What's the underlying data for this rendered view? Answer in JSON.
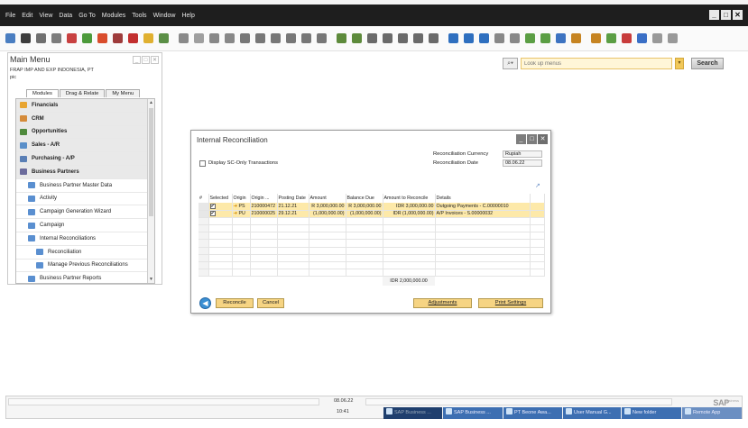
{
  "menubar": {
    "items": [
      "File",
      "Edit",
      "View",
      "Data",
      "Go To",
      "Modules",
      "Tools",
      "Window",
      "Help"
    ],
    "window_buttons": [
      "_",
      "□",
      "✕"
    ]
  },
  "search": {
    "placeholder": "Look up menus",
    "button": "Search"
  },
  "main_menu": {
    "title": "Main Menu",
    "company": "FRAP IMP AND EXP INDONESIA, PT",
    "user": "pic",
    "tabs": [
      "Modules",
      "Drag & Relate",
      "My Menu"
    ],
    "items": [
      {
        "label": "Financials",
        "level": 0,
        "color": "#e8a531"
      },
      {
        "label": "CRM",
        "level": 0,
        "color": "#d58b3a"
      },
      {
        "label": "Opportunities",
        "level": 0,
        "color": "#4f8a3c"
      },
      {
        "label": "Sales - A/R",
        "level": 0,
        "color": "#5a8fc9"
      },
      {
        "label": "Purchasing - A/P",
        "level": 0,
        "color": "#5a7fb5"
      },
      {
        "label": "Business Partners",
        "level": 0,
        "color": "#6b6b9c"
      },
      {
        "label": "Business Partner Master Data",
        "level": 1
      },
      {
        "label": "Activity",
        "level": 1
      },
      {
        "label": "Campaign Generation Wizard",
        "level": 1
      },
      {
        "label": "Campaign",
        "level": 1
      },
      {
        "label": "Internal Reconciliations",
        "level": 1
      },
      {
        "label": "Reconciliation",
        "level": 2
      },
      {
        "label": "Manage Previous Reconciliations",
        "level": 2
      },
      {
        "label": "Business Partner Reports",
        "level": 1
      }
    ]
  },
  "dialog": {
    "title": "Internal Reconciliation",
    "display_sc_only_label": "Display SC-Only Transactions",
    "reconciliation_currency_label": "Reconciliation Currency",
    "reconciliation_currency": "Rupiah",
    "reconciliation_date_label": "Reconciliation Date",
    "reconciliation_date": "08.06.22",
    "columns": [
      "#",
      "Selected",
      "Origin",
      "Origin ...",
      "Posting Date",
      "Amount",
      "Balance Due",
      "Amount to Reconcile",
      "Details"
    ],
    "rows": [
      {
        "origin": "PS",
        "origin_no": "210000472",
        "posting_date": "21.12.21",
        "amount": "R 3,000,000.00",
        "balance_due": "R 3,000,000.00",
        "amount_to_reconcile": "IDR 3,000,000.00",
        "details": "Outgoing Payments - C.00000010"
      },
      {
        "origin": "PU",
        "origin_no": "210000025",
        "posting_date": "29.12.21",
        "amount": "(1,000,000.00)",
        "balance_due": "(1,000,000.00)",
        "amount_to_reconcile": "IDR (1,000,000.00)",
        "details": "A/P Invoices - S.00000032"
      }
    ],
    "total": "IDR 2,000,000.00",
    "buttons": {
      "reconcile": "Reconcile",
      "cancel": "Cancel",
      "adjustments": "Adjustments",
      "print_settings": "Print Settings"
    }
  },
  "statusbar": {
    "date": "08.06.22",
    "time": "10:41",
    "brand": "SAP",
    "brand_sub": "Business"
  },
  "taskbar": [
    "SAP Business ...",
    "SAP Business ...",
    "PT Beone Awa...",
    "User Manual G...",
    "New folder",
    "Remote App"
  ]
}
